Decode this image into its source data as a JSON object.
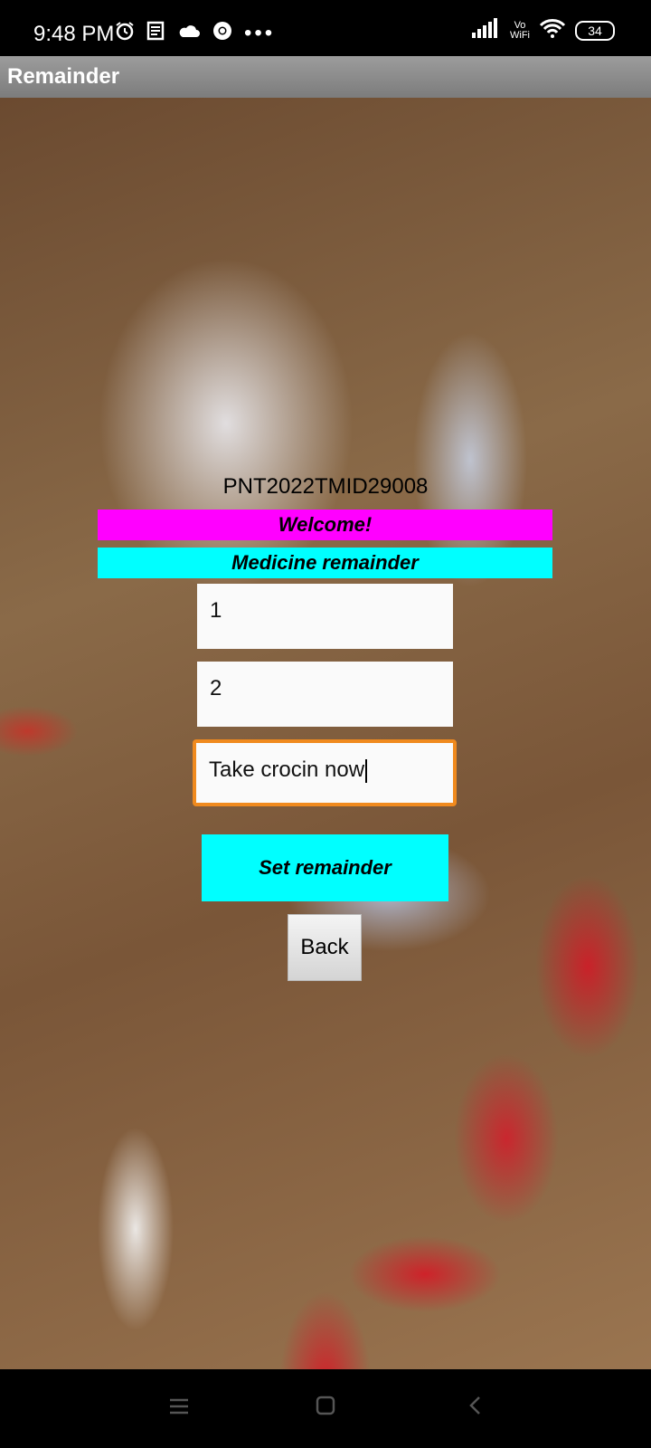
{
  "status_bar": {
    "time": "9:48 PM",
    "icons_left": [
      "alarm-icon",
      "news-icon",
      "cloud-icon",
      "chrome-icon",
      "more-icon"
    ],
    "vowifi": "Vo\nWiFi",
    "battery": "34"
  },
  "app_bar": {
    "title": "Remainder"
  },
  "main": {
    "id_text": "PNT2022TMID29008",
    "welcome_banner": "Welcome!",
    "medicine_banner": "Medicine remainder",
    "field_1_value": "1",
    "field_2_value": "2",
    "field_3_value": "Take crocin now",
    "set_button_label": "Set remainder",
    "back_button_label": "Back"
  },
  "colors": {
    "welcome_bg": "#ff00ff",
    "medicine_bg": "#00ffff",
    "set_button_bg": "#00ffff",
    "focus_border": "#f08a1e",
    "app_bar": "#8c8c8c"
  },
  "nav_bar": {
    "icons": [
      "menu-icon",
      "home-icon",
      "back-icon"
    ]
  }
}
